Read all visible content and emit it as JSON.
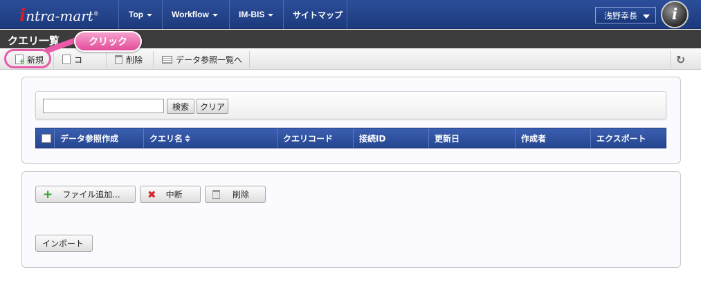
{
  "header": {
    "logo": {
      "prefix": "i",
      "text": "ntra-mart",
      "reg": "®"
    },
    "nav": [
      {
        "label": "Top"
      },
      {
        "label": "Workflow"
      },
      {
        "label": "IM-BIS"
      },
      {
        "label": "サイトマップ"
      }
    ],
    "user": {
      "name": "浅野幸長"
    },
    "avatar_letter": "i"
  },
  "page": {
    "title": "クエリ一覧"
  },
  "toolbar": {
    "new_label": "新規",
    "copy_label": "コ",
    "delete_label": "削除",
    "data_ref_label": "データ参照一覧へ"
  },
  "callout": {
    "label": "クリック",
    "color": "#e95aa8"
  },
  "search": {
    "value": "",
    "search_label": "検索",
    "clear_label": "クリア"
  },
  "grid": {
    "columns": [
      "データ参照作成",
      "クエリ名",
      "クエリコード",
      "接続ID",
      "更新日",
      "作成者",
      "エクスポート"
    ]
  },
  "actions": {
    "add_file_label": "ファイル追加...",
    "abort_label": "中断",
    "delete_label": "削除",
    "import_label": "インポート"
  },
  "colors": {
    "header_blue": "#1c3a7c",
    "grid_header_blue": "#25458f",
    "accent_pink": "#e95aa8"
  }
}
